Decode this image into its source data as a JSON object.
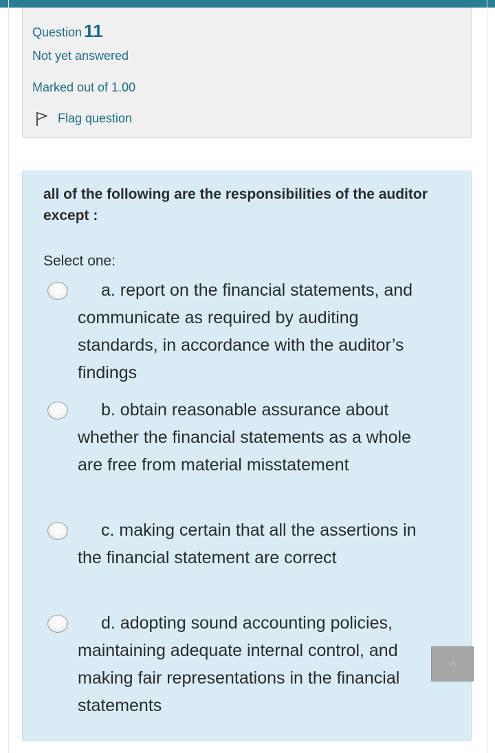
{
  "info": {
    "question_label": "Question",
    "question_number": "11",
    "state": "Not yet answered",
    "grade": "Marked out of 1.00",
    "flag_label": "Flag question",
    "flag_icon": "flag-icon"
  },
  "question": {
    "text": "all of the following are the responsibilities of the auditor except :",
    "prompt": "Select one:",
    "options": [
      {
        "label": "a. report on the financial statements, and communicate as required by auditing standards, in accordance with the auditor’s findings"
      },
      {
        "label": "b. obtain reasonable assurance about whether the financial statements as a whole are free from material misstatement"
      },
      {
        "label": "c. making certain that all the assertions in the financial statement are correct"
      },
      {
        "label": "d. adopting sound accounting policies, maintaining adequate internal control, and making fair representations in the financial statements"
      }
    ]
  },
  "colors": {
    "header_bar": "#2c7e94",
    "info_text": "#1d6b86",
    "info_bg": "#f0f0f0",
    "content_bg": "#d9ecf6"
  },
  "scroll_top_icon": "chevron-up-icon"
}
